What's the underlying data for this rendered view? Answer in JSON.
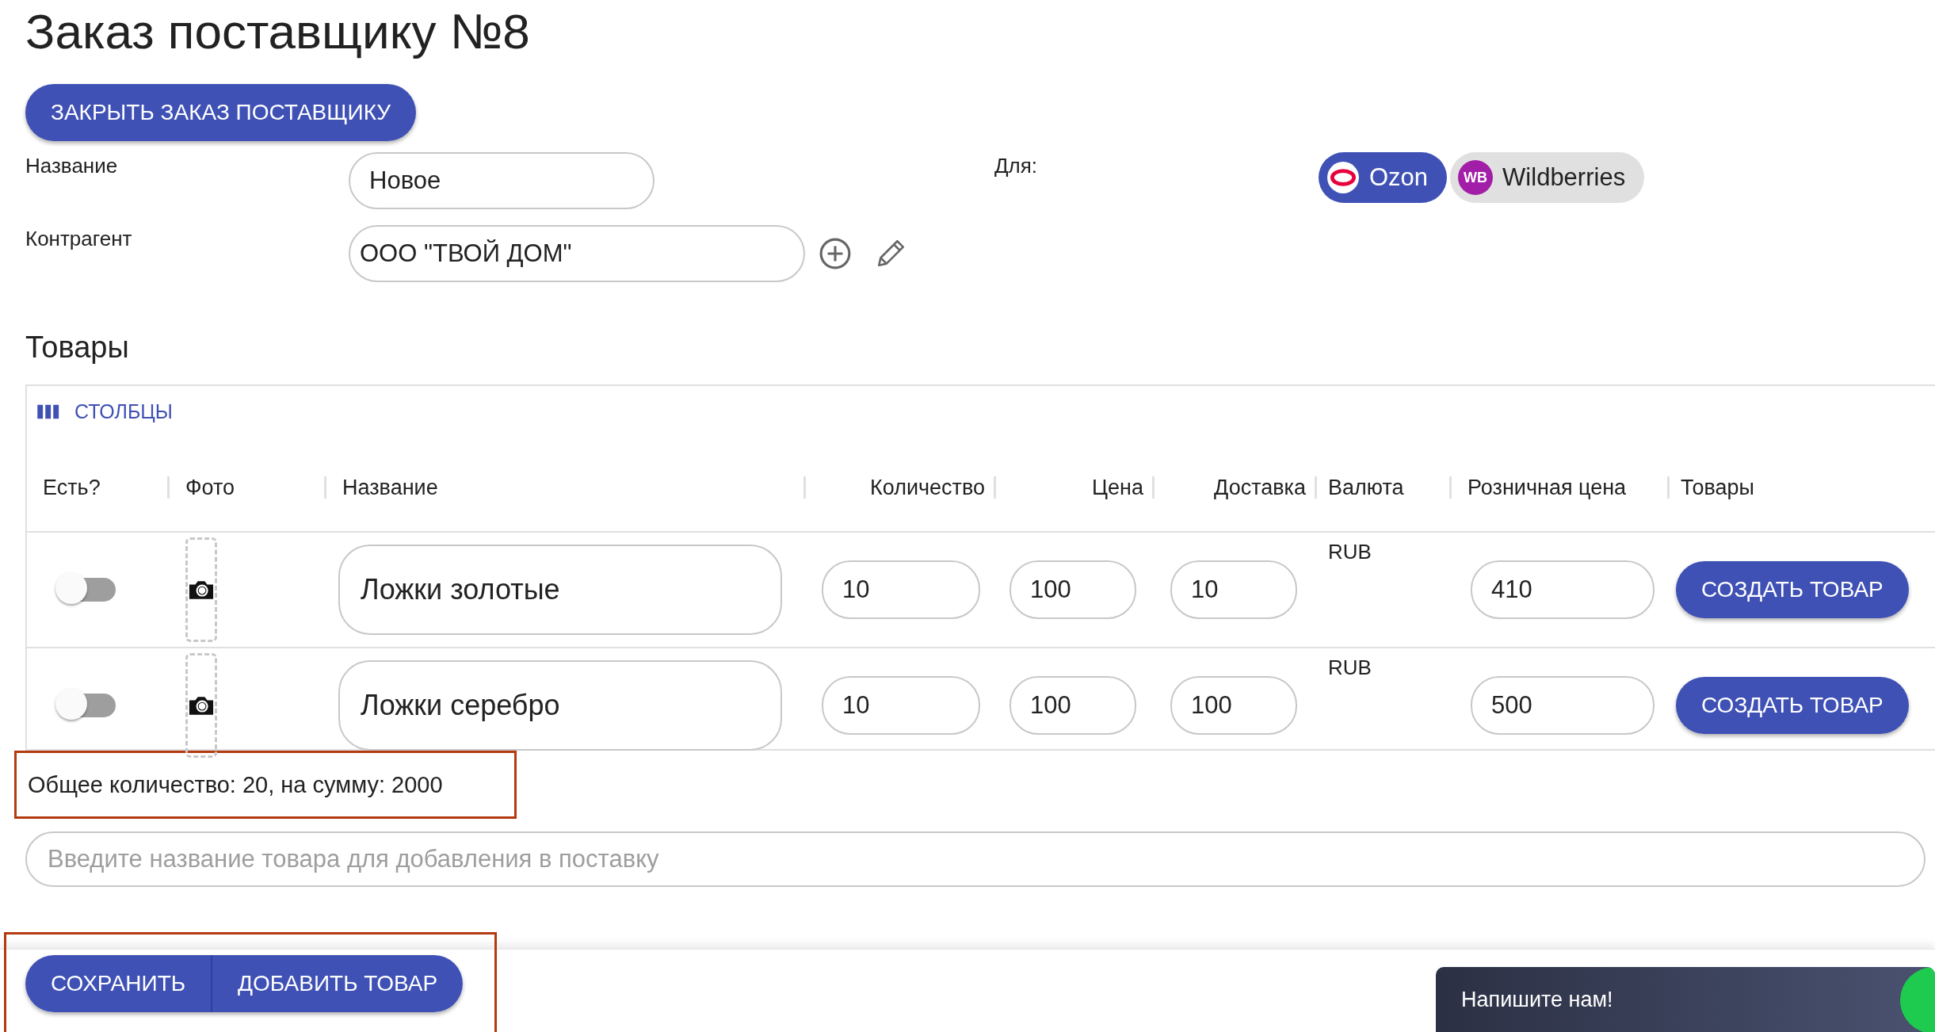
{
  "title": "Заказ поставщику №8",
  "close_button": "ЗАКРЫТЬ ЗАКАЗ ПОСТАВЩИКУ",
  "fields": [
    {
      "label": "Название",
      "value": "Новое",
      "kind": "text"
    },
    {
      "label": "Контрагент",
      "value": "ООО \"ТВОЙ ДОМ\"",
      "kind": "picker"
    }
  ],
  "for": {
    "label": "Для:",
    "marketplaces": [
      {
        "label": "Ozon",
        "selected": true,
        "kind": "ozon"
      },
      {
        "label": "Wildberries",
        "selected": false,
        "kind": "wb",
        "badge": "WB"
      }
    ]
  },
  "products": {
    "title": "Товары",
    "columns_button": "СТОЛБЦЫ",
    "columns": [
      "Есть?",
      "Фото",
      "Название",
      "Количество",
      "Цена",
      "Доставка",
      "Валюта",
      "Розничная цена",
      "Товары"
    ],
    "rows": [
      {
        "in_stock": false,
        "name": "Ложки золотые",
        "quantity": "10",
        "price": "100",
        "delivery": "10",
        "currency": "RUB",
        "retail_price": "410",
        "action": "СОЗДАТЬ ТОВАР"
      },
      {
        "in_stock": false,
        "name": "Ложки серебро",
        "quantity": "10",
        "price": "100",
        "delivery": "100",
        "currency": "RUB",
        "retail_price": "500",
        "action": "СОЗДАТЬ ТОВАР"
      }
    ]
  },
  "total": {
    "text": "Общее количество: 20, на сумму: 2000",
    "highlighted": true
  },
  "search": {
    "placeholder": "Введите название товара для добавления в поставку"
  },
  "footer": {
    "buttons": [
      "СОХРАНИТЬ",
      "ДОБАВИТЬ ТОВАР"
    ],
    "highlighted": true
  },
  "chat": {
    "label": "Напишите нам!"
  }
}
